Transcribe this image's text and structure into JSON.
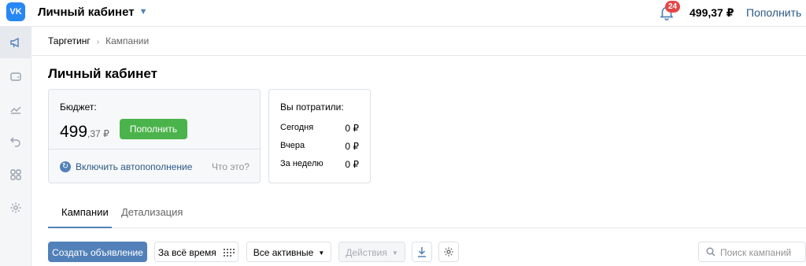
{
  "topbar": {
    "logo_text": "VK",
    "account_title": "Личный кабинет",
    "notifications_count": "24",
    "balance": "499,37 ₽",
    "topup_link": "Пополнить"
  },
  "sidebar": {
    "items": [
      {
        "icon": "megaphone-icon",
        "active": true
      },
      {
        "icon": "wallet-icon",
        "active": false
      },
      {
        "icon": "chart-icon",
        "active": false
      },
      {
        "icon": "undo-icon",
        "active": false
      },
      {
        "icon": "grid-icon",
        "active": false
      },
      {
        "icon": "gear-icon",
        "active": false
      }
    ]
  },
  "breadcrumb": {
    "root": "Таргетинг",
    "separator": "›",
    "current": "Кампании"
  },
  "page": {
    "title": "Личный кабинет"
  },
  "budget": {
    "label": "Бюджет:",
    "amount_int": "499",
    "amount_frac": ",37 ₽",
    "topup_button": "Пополнить",
    "auto_topup_link": "Включить автопополнение",
    "what_is_it": "Что это?"
  },
  "spent": {
    "title": "Вы потратили:",
    "rows": [
      {
        "label": "Сегодня",
        "value": "0 ₽"
      },
      {
        "label": "Вчера",
        "value": "0 ₽"
      },
      {
        "label": "За неделю",
        "value": "0 ₽"
      }
    ]
  },
  "tabs": [
    {
      "label": "Кампании",
      "active": true
    },
    {
      "label": "Детализация",
      "active": false
    }
  ],
  "toolbar": {
    "create_button": "Создать объявление",
    "period_button": "За всё время",
    "filter_select": "Все активные",
    "actions_select": "Действия",
    "search_placeholder": "Поиск кампаний"
  },
  "colors": {
    "accent": "#5181b8",
    "link": "#2a5885",
    "success": "#4bb34b",
    "badge": "#e64646",
    "vk_blue": "#2787f5"
  }
}
